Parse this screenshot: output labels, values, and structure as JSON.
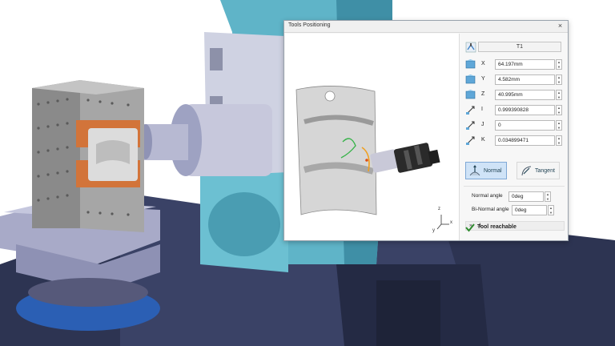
{
  "dialog": {
    "title": "Tools Positioning",
    "close_glyph": "×",
    "tool_name": "T1",
    "coordinates": [
      {
        "label": "X",
        "value": "64.197mm",
        "icon": "x-axis-icon"
      },
      {
        "label": "Y",
        "value": "4.582mm",
        "icon": "y-axis-icon"
      },
      {
        "label": "Z",
        "value": "40.995mm",
        "icon": "z-axis-icon"
      },
      {
        "label": "I",
        "value": "0.999390828",
        "icon": "i-vector-icon"
      },
      {
        "label": "J",
        "value": "0",
        "icon": "j-vector-icon"
      },
      {
        "label": "K",
        "value": "0.034899471",
        "icon": "k-vector-icon"
      }
    ],
    "modes": {
      "normal": "Normal",
      "tangent": "Tangent",
      "selected": "Normal"
    },
    "normal_angle": {
      "label": "Normal angle",
      "value": "0deg"
    },
    "binormal_angle": {
      "label": "Bi-Normal angle",
      "value": "0deg"
    },
    "expander": {
      "glyph": "»",
      "label": ".1"
    },
    "status": {
      "text": "Tool reachable",
      "icon": "checkmark-icon",
      "color": "#2e8b2e"
    },
    "axis_triad": {
      "labels": [
        "z",
        "x",
        "y"
      ]
    }
  },
  "colors": {
    "accent": "#3f83c8",
    "machine_teal": "#5fb4c8",
    "machine_navy": "#2e3c6e",
    "fixture_orange": "#d2743a"
  }
}
